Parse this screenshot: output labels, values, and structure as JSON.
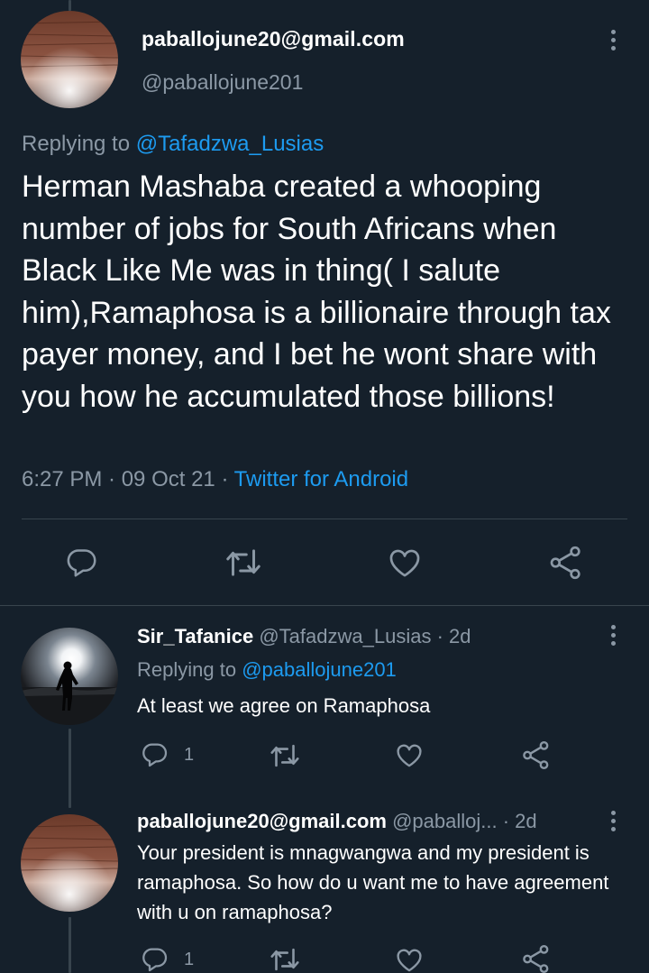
{
  "main_tweet": {
    "display_name": "paballojune20@gmail.com",
    "handle": "@paballojune201",
    "replying_prefix": "Replying to",
    "replying_to": "@Tafadzwa_Lusias",
    "text": "Herman Mashaba created a whooping number of jobs for South Africans when Black Like Me was in thing( I salute him),Ramaphosa is a billionaire through tax payer money, and I bet he wont share with you how he accumulated those billions!",
    "time": "6:27 PM · 09 Oct 21 · ",
    "source": "Twitter for Android",
    "icons": [
      "reply-icon",
      "retweet-icon",
      "like-icon",
      "share-icon",
      "more-icon"
    ]
  },
  "replies": [
    {
      "display_name": "Sir_Tafanice",
      "handle": "@Tafadzwa_Lusias",
      "age": " · 2d",
      "replying_prefix": "Replying to",
      "replying_to": "@paballojune201",
      "text": "At least we agree on Ramaphosa",
      "reply_count": "1"
    },
    {
      "display_name": "paballojune20@gmail.com",
      "handle": "@paballoj...",
      "age": " · 2d",
      "text": "Your president is mnagwangwa and my president is ramaphosa. So how do u want me  to have agreement with u on ramaphosa?",
      "reply_count": "1"
    }
  ],
  "colors": {
    "background": "#15202b",
    "secondary_text": "#8b98a5",
    "link": "#1d9bf0",
    "divider": "#38444d"
  }
}
